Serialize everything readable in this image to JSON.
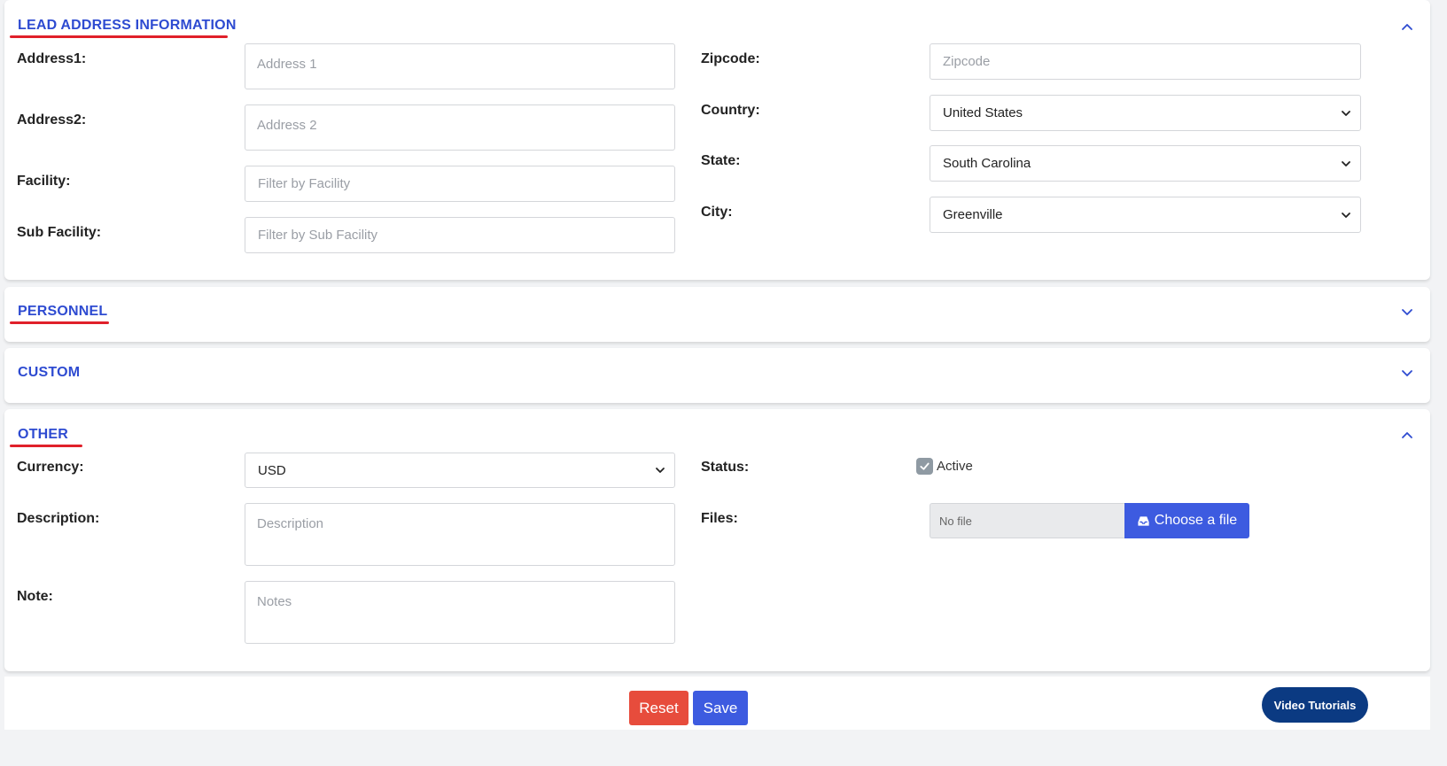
{
  "lead_address": {
    "title": "LEAD ADDRESS INFORMATION",
    "labels": {
      "address1": "Address1:",
      "address2": "Address2:",
      "facility": "Facility:",
      "sub_facility": "Sub Facility:",
      "zipcode": "Zipcode:",
      "country": "Country:",
      "state": "State:",
      "city": "City:"
    },
    "placeholders": {
      "address1": "Address 1",
      "address2": "Address 2",
      "facility": "Filter by Facility",
      "sub_facility": "Filter by Sub Facility",
      "zipcode": "Zipcode"
    },
    "values": {
      "country": "United States",
      "state": "South Carolina",
      "city": "Greenville"
    }
  },
  "personnel": {
    "title": "PERSONNEL"
  },
  "custom": {
    "title": "CUSTOM"
  },
  "other": {
    "title": "OTHER",
    "labels": {
      "currency": "Currency:",
      "description": "Description:",
      "note": "Note:",
      "status": "Status:",
      "files": "Files:"
    },
    "placeholders": {
      "description": "Description",
      "note": "Notes"
    },
    "values": {
      "currency": "USD",
      "status_checked": true,
      "status_label": "Active",
      "file_name": "No file",
      "choose_file_label": "Choose a file"
    }
  },
  "actions": {
    "reset_label": "Reset",
    "save_label": "Save",
    "video_tutorials_label": "Video Tutorials"
  },
  "colors": {
    "accent": "#2e4bd1",
    "underline": "#e0202a",
    "reset": "#e74c3c",
    "save": "#3d5be0",
    "video": "#0b3a82"
  },
  "icons": {
    "expanded": "chevron-up-icon",
    "collapsed": "chevron-down-icon",
    "select": "chevron-down-icon",
    "checkbox": "check-icon",
    "upload": "inbox-tray-icon"
  }
}
